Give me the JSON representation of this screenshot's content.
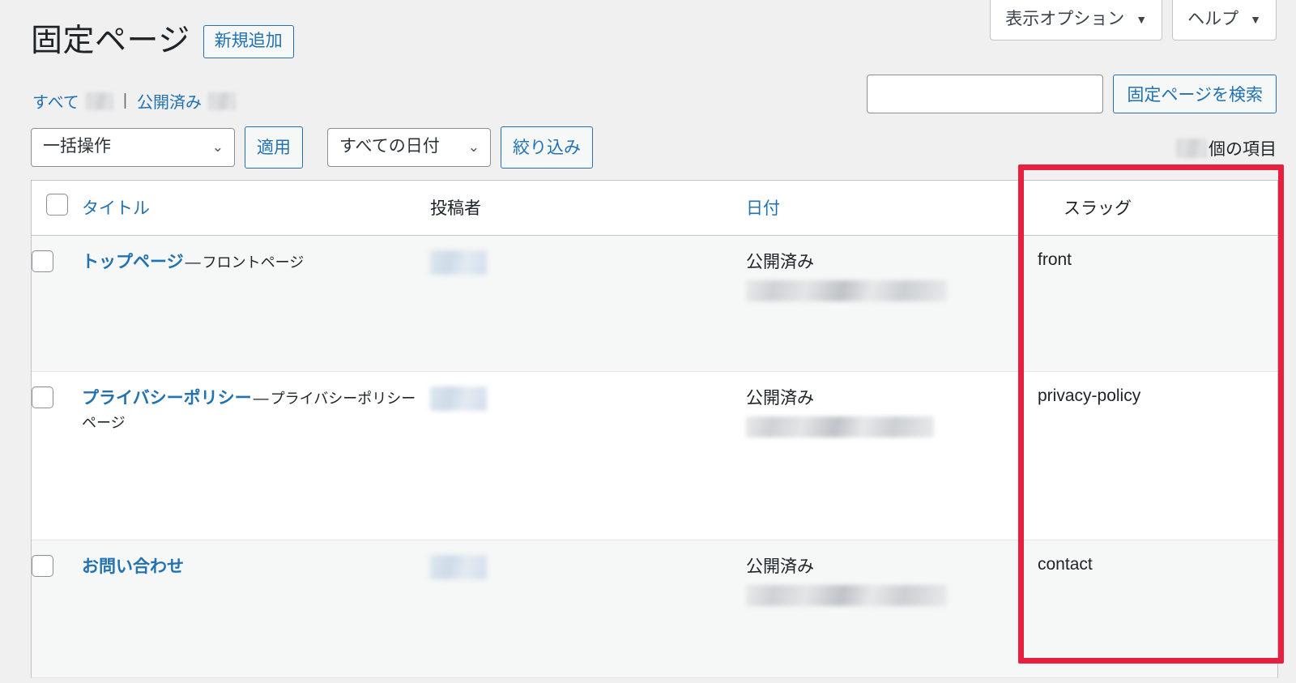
{
  "screen_meta": {
    "screen_options_label": "表示オプション",
    "help_label": "ヘルプ",
    "caret": "▼"
  },
  "header": {
    "page_title": "固定ページ",
    "add_new_label": "新規追加"
  },
  "status_links": {
    "all_label": "すべて",
    "separator": "|",
    "published_label": "公開済み"
  },
  "search": {
    "value": "",
    "placeholder": "",
    "submit_label": "固定ページを検索"
  },
  "tablenav": {
    "bulk_action_selected": "一括操作",
    "apply_label": "適用",
    "date_filter_selected": "すべての日付",
    "filter_label": "絞り込み",
    "item_count_suffix": "個の項目",
    "chevron": "⌄"
  },
  "table": {
    "columns": {
      "title": "タイトル",
      "author": "投稿者",
      "date": "日付",
      "slug": "スラッグ"
    },
    "rows": [
      {
        "title": "トップページ",
        "dash": "—",
        "note": "フロントページ",
        "status": "公開済み",
        "slug": "front"
      },
      {
        "title": "プライバシーポリシー",
        "dash": "—",
        "note": "プライバシーポリシーページ",
        "status": "公開済み",
        "slug": "privacy-policy"
      },
      {
        "title": "お問い合わせ",
        "dash": "",
        "note": "",
        "status": "公開済み",
        "slug": "contact"
      }
    ]
  },
  "annotation": {
    "highlight_color": "#e8203f",
    "highlights_column": "スラッグ"
  },
  "colors": {
    "accent_link": "#2271b1",
    "text": "#1d2327",
    "page_background": "#f0f0f1",
    "row_alt_background": "#f6f7f7",
    "border": "#c3c4c7"
  }
}
